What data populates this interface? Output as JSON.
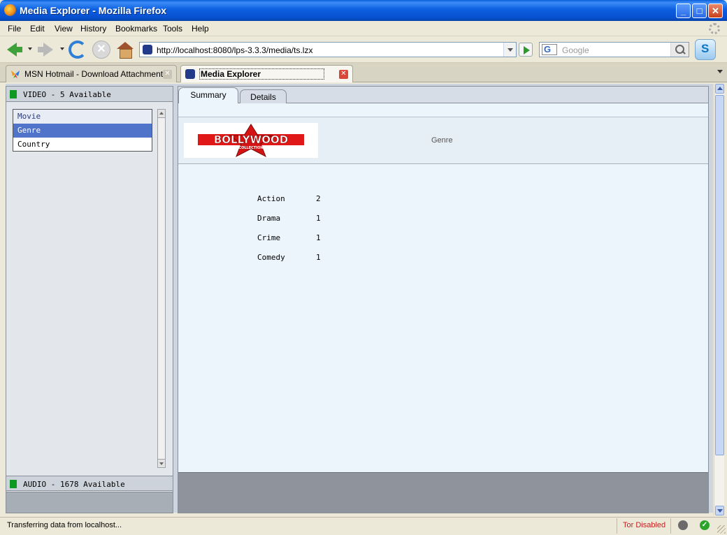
{
  "window": {
    "title": "Media Explorer - Mozilla Firefox",
    "minimize_label": "_",
    "maximize_label": "□",
    "close_label": "✕"
  },
  "menu": [
    "File",
    "Edit",
    "View",
    "History",
    "Bookmarks",
    "Tools",
    "Help"
  ],
  "nav": {
    "url": "http://localhost:8080/lps-3.3.3/media/ts.lzx",
    "search_placeholder": "Google",
    "search_engine_glyph": "G",
    "stop_glyph": "✕"
  },
  "tabs": [
    {
      "label": "MSN Hotmail - Download Attachment",
      "active": false
    },
    {
      "label": "Media Explorer",
      "active": true
    }
  ],
  "tab_close_glyph": "✕",
  "left": {
    "video_header": "VIDEO - 5 Available",
    "list_items": [
      "Movie",
      "Genre",
      "Country"
    ],
    "selected_index": 1,
    "audio_header": "AUDIO - 1678 Available"
  },
  "right": {
    "tabs": [
      "Summary",
      "Details"
    ],
    "active_tab": "Summary",
    "header_title": "Genre",
    "logo_text": "BOLLYWOOD",
    "logo_subtext": "COLLECTION",
    "stats": [
      {
        "name": "Action",
        "count": "2"
      },
      {
        "name": "Drama",
        "count": "1"
      },
      {
        "name": "Crime",
        "count": "1"
      },
      {
        "name": "Comedy",
        "count": "1"
      }
    ]
  },
  "status": {
    "text": "Transferring data from localhost...",
    "tor": "Tor Disabled",
    "ok_glyph": "✓"
  },
  "colors": {
    "accent_green": "#0e9a22",
    "selection_blue": "#4f74c9",
    "tor_red": "#c41e1e"
  }
}
